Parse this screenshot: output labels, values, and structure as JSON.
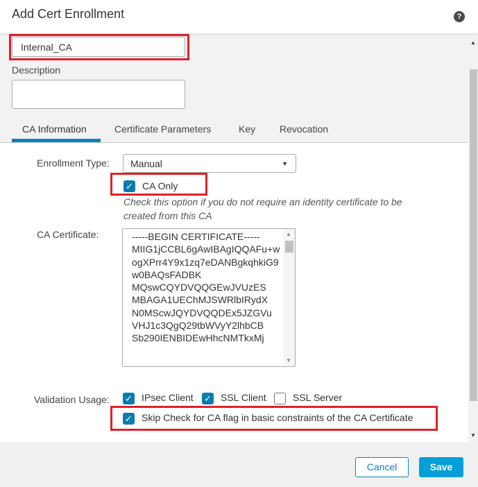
{
  "dialog": {
    "title": "Add Cert Enrollment",
    "help_icon": "?"
  },
  "form": {
    "name_value": "Internal_CA",
    "description_label": "Description",
    "description_value": "",
    "tabs": [
      {
        "label": "CA Information",
        "active": true
      },
      {
        "label": "Certificate Parameters"
      },
      {
        "label": "Key"
      },
      {
        "label": "Revocation"
      }
    ],
    "enrollment_type_label": "Enrollment Type:",
    "enrollment_type_value": "Manual",
    "ca_only_label": "CA Only",
    "ca_only_checked": true,
    "ca_only_hint": "Check this option if you do not require an identity certificate to be created from this CA",
    "ca_certificate_label": "CA Certificate:",
    "ca_certificate_value": "-----BEGIN CERTIFICATE-----\nMIIG1jCCBL6gAwIBAgIQQAFu+wogXPrr4Y9x1zq7eDANBgkqhkiG9w0BAQsFADBK\nMQswCQYDVQQGEwJVUzES\nMBAGA1UEChMJSWRlbIRydX\nN0MScwJQYDVQQDEx5JZGVu\nVHJ1c3QgQ29tbWVyY2lhbCB\nSb290IENBIDEwHhcNMTkxMj",
    "validation_usage_label": "Validation Usage:",
    "validation": [
      {
        "label": "IPsec Client",
        "checked": true
      },
      {
        "label": "SSL Client",
        "checked": true
      },
      {
        "label": "SSL Server",
        "checked": false
      }
    ],
    "skip_check_label": "Skip Check for CA flag in basic constraints of the CA Certificate",
    "skip_check_checked": true
  },
  "footer": {
    "cancel_label": "Cancel",
    "save_label": "Save"
  },
  "colors": {
    "accent": "#049fd9",
    "highlight": "#e0202a",
    "checkbox": "#0a7cb0"
  }
}
